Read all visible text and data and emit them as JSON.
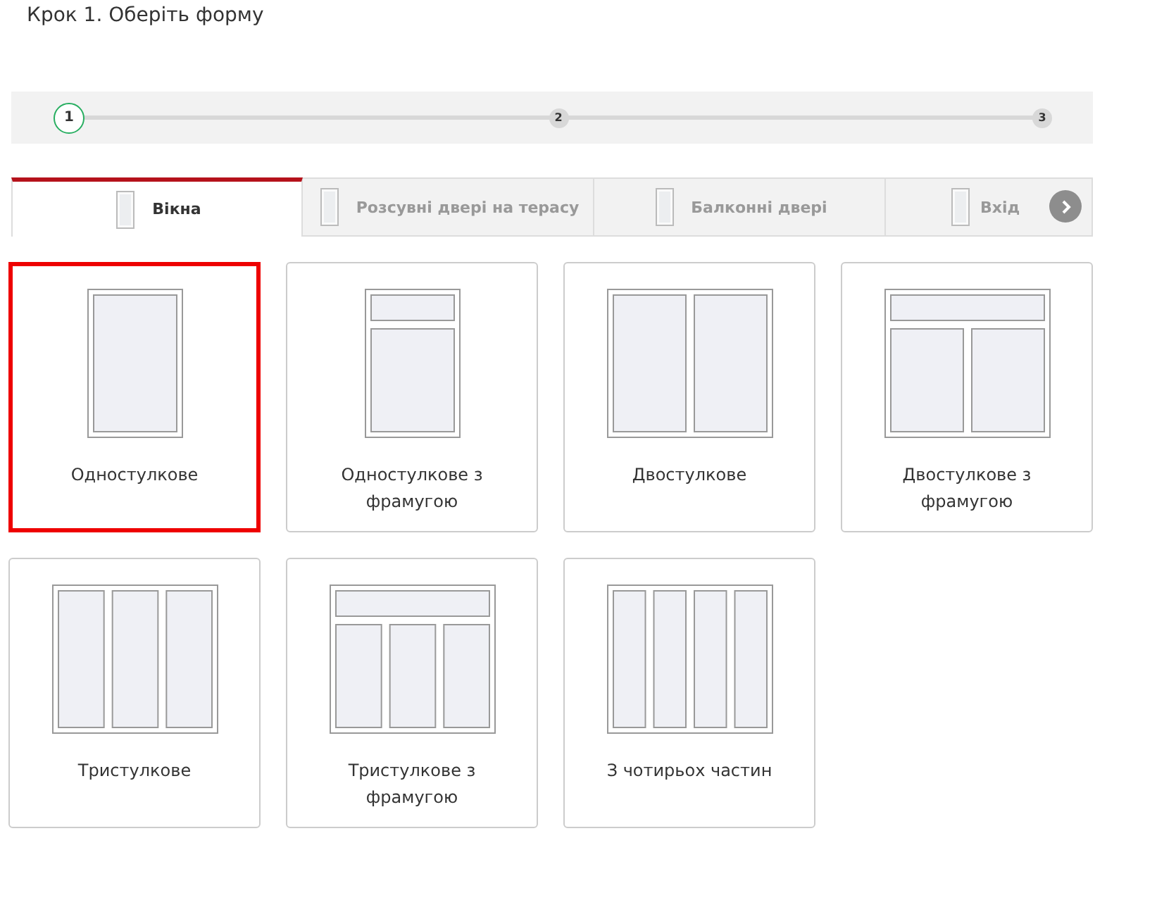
{
  "title": "Крок 1. Оберіть форму",
  "steps": [
    {
      "label": "1",
      "selected": true
    },
    {
      "label": "2",
      "selected": false
    },
    {
      "label": "3",
      "selected": false
    }
  ],
  "tabs": [
    {
      "label": "Вікна",
      "selected": true
    },
    {
      "label": "Розсувні двері на терасу",
      "selected": false
    },
    {
      "label": "Балконні двері",
      "selected": false
    },
    {
      "label": "Вхід",
      "selected": false
    }
  ],
  "options": [
    {
      "label": "Одностулкове",
      "kind": "one",
      "selected": true
    },
    {
      "label": "Одностулкове з фрамугою",
      "kind": "one-transom",
      "selected": false
    },
    {
      "label": "Двостулкове",
      "kind": "two",
      "selected": false
    },
    {
      "label": "Двостулкове з фрамугою",
      "kind": "two-transom",
      "selected": false
    },
    {
      "label": "Тристулкове",
      "kind": "three",
      "selected": false
    },
    {
      "label": "Тристулкове з фрамугою",
      "kind": "three-transom",
      "selected": false
    },
    {
      "label": "З чотирьох частин",
      "kind": "four",
      "selected": false
    }
  ]
}
